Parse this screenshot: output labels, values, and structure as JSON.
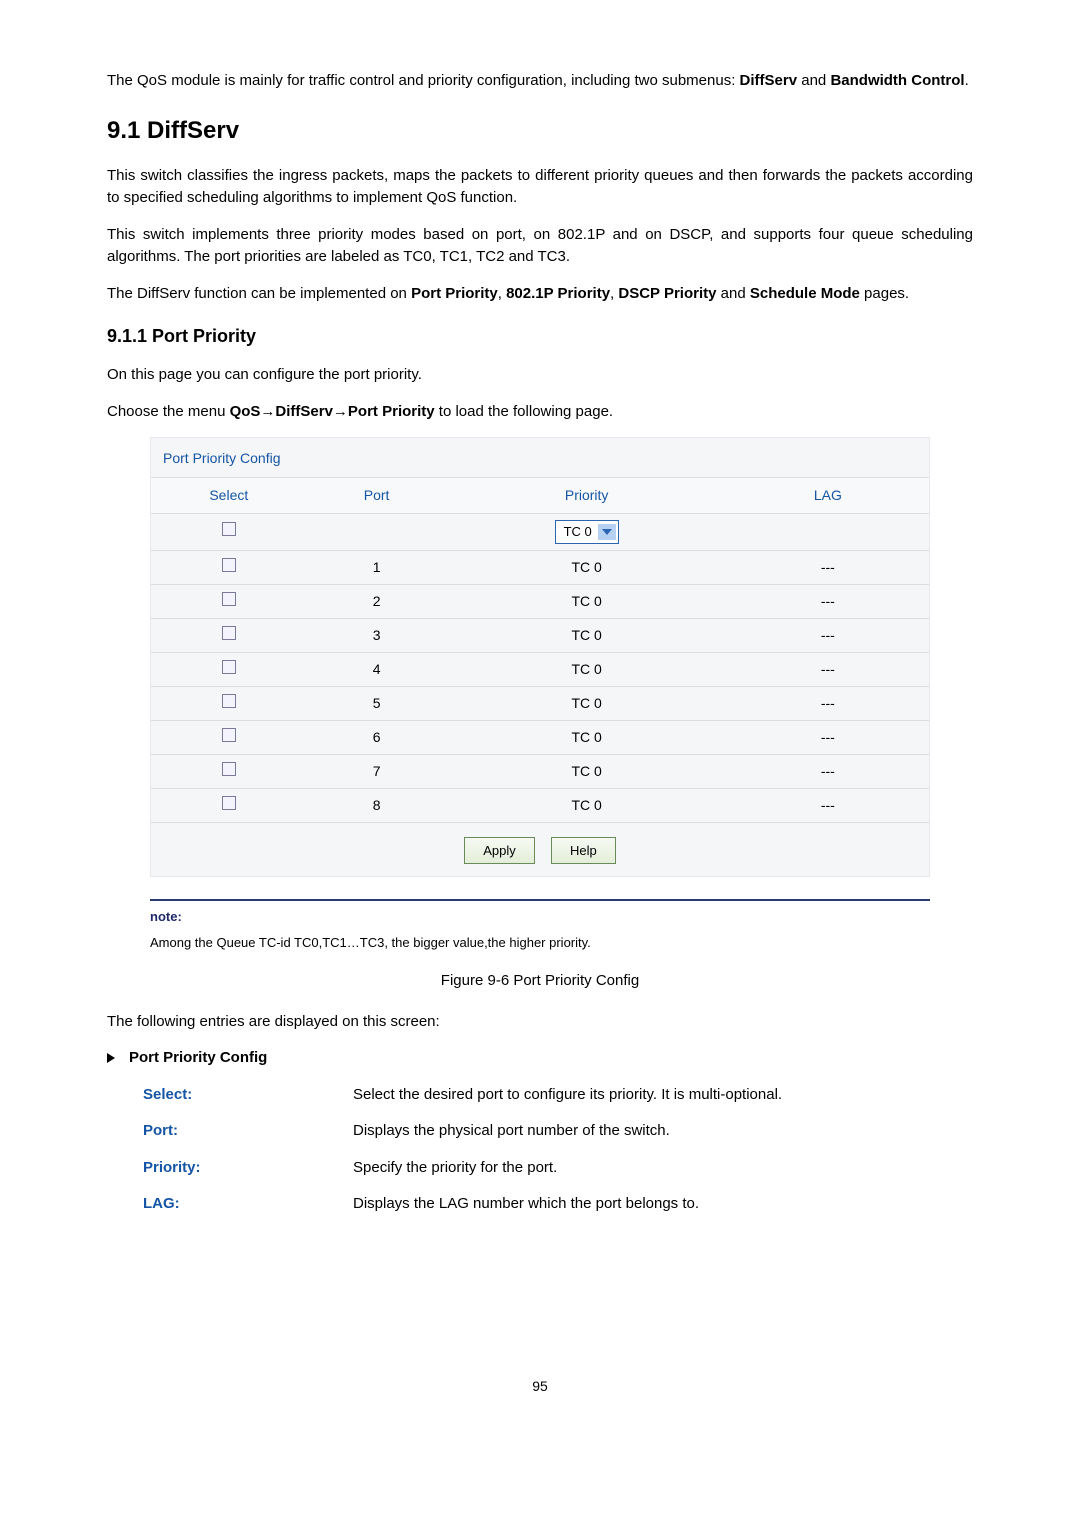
{
  "intro": {
    "p1_pre": "The QoS module is mainly for traffic control and priority configuration, including two submenus: ",
    "p1_b1": "DiffServ",
    "p1_mid": " and ",
    "p1_b2": "Bandwidth Control",
    "p1_post": "."
  },
  "section": {
    "heading": "9.1   DiffServ",
    "p1": "This switch classifies the ingress packets, maps the packets to different priority queues and then forwards the packets according to specified scheduling algorithms to implement QoS function.",
    "p2": "This switch implements three priority modes based on port, on 802.1P and on DSCP, and supports four queue scheduling algorithms. The port priorities are labeled as TC0, TC1, TC2 and TC3.",
    "p3_pre": "The DiffServ function can be implemented on ",
    "p3_b1": "Port Priority",
    "p3_sep": ", ",
    "p3_b2": "802.1P Priority",
    "p3_b3": "DSCP Priority",
    "p3_and": " and ",
    "p3_b4": "Schedule Mode",
    "p3_post": " pages."
  },
  "subsection": {
    "heading": "9.1.1 Port Priority",
    "p1": "On this page you can configure the port priority.",
    "p2_pre": "Choose the menu ",
    "p2_b": "QoS→DiffServ→Port Priority",
    "p2_post": " to load the following page."
  },
  "panel": {
    "title": "Port Priority Config",
    "headers": {
      "select": "Select",
      "port": "Port",
      "priority": "Priority",
      "lag": "LAG"
    },
    "dropdown": "TC 0",
    "rows": [
      {
        "port": "1",
        "priority": "TC 0",
        "lag": "---"
      },
      {
        "port": "2",
        "priority": "TC 0",
        "lag": "---"
      },
      {
        "port": "3",
        "priority": "TC 0",
        "lag": "---"
      },
      {
        "port": "4",
        "priority": "TC 0",
        "lag": "---"
      },
      {
        "port": "5",
        "priority": "TC 0",
        "lag": "---"
      },
      {
        "port": "6",
        "priority": "TC 0",
        "lag": "---"
      },
      {
        "port": "7",
        "priority": "TC 0",
        "lag": "---"
      },
      {
        "port": "8",
        "priority": "TC 0",
        "lag": "---"
      }
    ],
    "buttons": {
      "apply": "Apply",
      "help": "Help"
    }
  },
  "note": {
    "label": "note:",
    "text": "Among the Queue TC-id TC0,TC1…TC3, the bigger value,the higher priority."
  },
  "caption": "Figure 9-6 Port Priority Config",
  "entries": {
    "intro": "The following entries are displayed on this screen:",
    "title": "Port Priority Config",
    "defs": [
      {
        "term": "Select:",
        "desc": "Select the desired port to configure its priority. It is multi-optional."
      },
      {
        "term": "Port:",
        "desc": "Displays the physical port number of the switch."
      },
      {
        "term": "Priority:",
        "desc": "Specify the priority for the port."
      },
      {
        "term": "LAG:",
        "desc": "Displays the LAG number which the port belongs to."
      }
    ]
  },
  "pagenum": "95"
}
